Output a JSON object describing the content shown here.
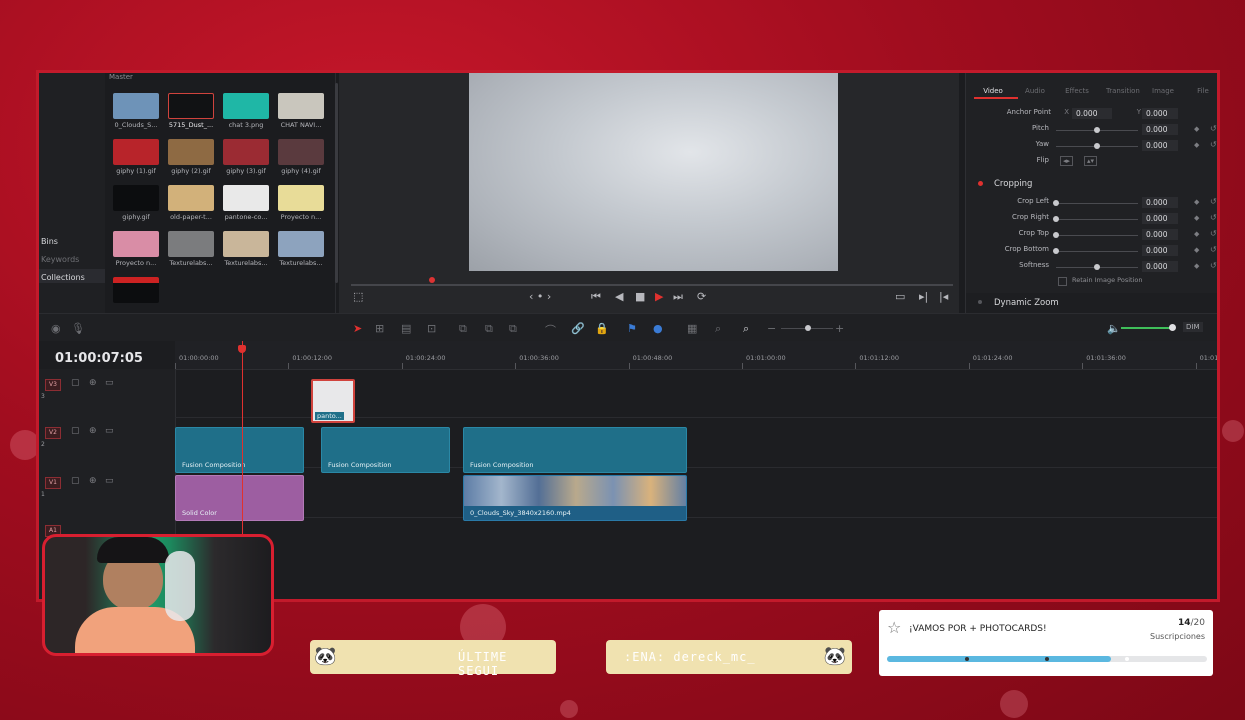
{
  "media_pool": {
    "title": "Master",
    "side": [
      "Bins",
      "Keywords",
      "Collections"
    ],
    "clips": [
      {
        "name": "0_Clouds_S...",
        "color": "#6e93b8"
      },
      {
        "name": "5715_Dust_...",
        "color": "#111214"
      },
      {
        "name": "chat 3.png",
        "color": "#1fb7a6"
      },
      {
        "name": "CHAT NAVI...",
        "color": "#c9c6bd"
      },
      {
        "name": "giphy (1).gif",
        "color": "#b8242a"
      },
      {
        "name": "giphy (2).gif",
        "color": "#8e6a43"
      },
      {
        "name": "giphy (3).gif",
        "color": "#9b2b33"
      },
      {
        "name": "giphy (4).gif",
        "color": "#5a3a3e"
      },
      {
        "name": "giphy.gif",
        "color": "#0c0d0f"
      },
      {
        "name": "old-paper-t...",
        "color": "#d2b17a"
      },
      {
        "name": "pantone-co...",
        "color": "#e9e9e9"
      },
      {
        "name": "Proyecto n...",
        "color": "#e8dc98"
      },
      {
        "name": "Proyecto n...",
        "color": "#d98da6"
      },
      {
        "name": "Texturelabs...",
        "color": "#7b7c7e"
      },
      {
        "name": "Texturelabs...",
        "color": "#c9b69a"
      },
      {
        "name": "Texturelabs...",
        "color": "#8da3be"
      }
    ]
  },
  "inspector": {
    "tabs": [
      "Video",
      "Audio",
      "Effects",
      "Transition",
      "Image",
      "File"
    ],
    "anchor": {
      "label": "Anchor Point",
      "x_label": "X",
      "x": "0.000",
      "y_label": "Y",
      "y": "0.000"
    },
    "params": [
      {
        "label": "Pitch",
        "value": "0.000"
      },
      {
        "label": "Yaw",
        "value": "0.000"
      }
    ],
    "flip_label": "Flip",
    "cropping_title": "Cropping",
    "crop": [
      {
        "label": "Crop Left",
        "value": "0.000"
      },
      {
        "label": "Crop Right",
        "value": "0.000"
      },
      {
        "label": "Crop Top",
        "value": "0.000"
      },
      {
        "label": "Crop Bottom",
        "value": "0.000"
      },
      {
        "label": "Softness",
        "value": "0.000"
      }
    ],
    "retain": "Retain Image Position",
    "dynamic_zoom": "Dynamic Zoom"
  },
  "toolbar": {
    "dim": "DIM"
  },
  "timeline": {
    "timecode": "01:00:07:05",
    "ruler": [
      "01:00:00:00",
      "01:00:12:00",
      "01:00:24:00",
      "01:00:36:00",
      "01:00:48:00",
      "01:01:00:00",
      "01:01:12:00",
      "01:01:24:00",
      "01:01:36:00",
      "01:01:48:00"
    ],
    "tracks": [
      {
        "badge": "V3",
        "num": "3"
      },
      {
        "badge": "V2",
        "num": "2"
      },
      {
        "badge": "V1",
        "num": "1"
      },
      {
        "badge": "A1",
        "num": ""
      }
    ],
    "clips": {
      "v3": "panto...",
      "v2": [
        "Fusion Composition",
        "Fusion Composition",
        "Fusion Composition"
      ],
      "v1_solid": "Solid Color",
      "v1_video": "0_Clouds_Sky_3840x2160.mp4"
    }
  },
  "overlay": {
    "banner_left": "ÚLTIME SEGUI",
    "banner_right": ":ENA: dereck_mc_",
    "goal": {
      "title": "¡VAMOS POR + PHOTOCARDS!",
      "current": "14",
      "target": "/20",
      "label": "Suscripciones",
      "progress": 0.7
    }
  }
}
